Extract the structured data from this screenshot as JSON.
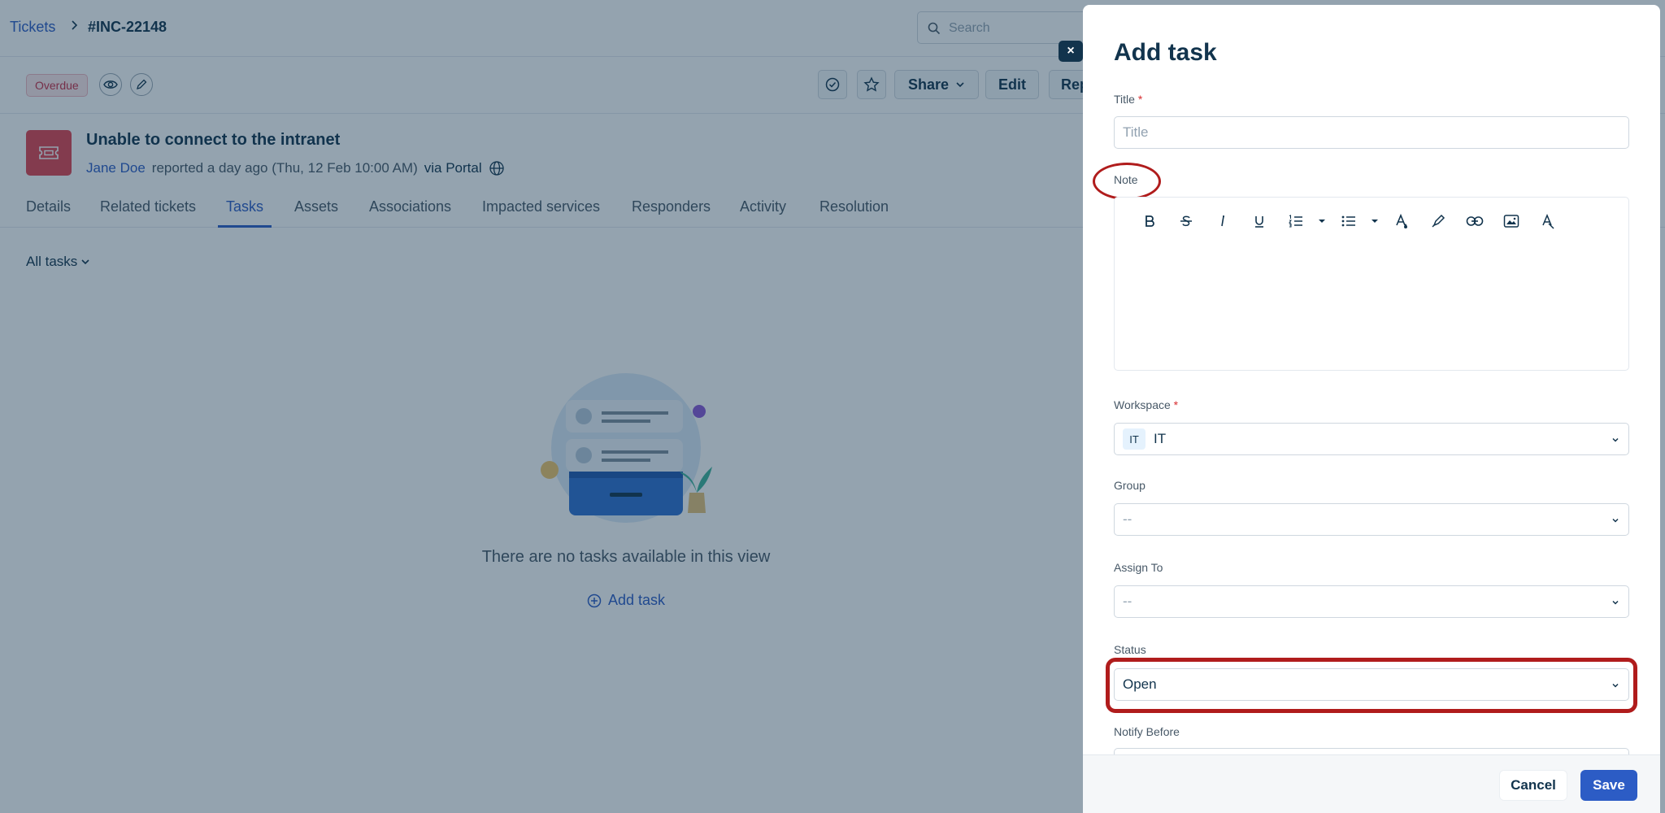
{
  "header": {
    "breadcrumb_root": "Tickets",
    "ticket_id": "#INC-22148",
    "search_placeholder": "Search"
  },
  "actionbar": {
    "status_badge": "Overdue",
    "share_label": "Share",
    "edit_label": "Edit",
    "reply_label": "Rep"
  },
  "ticket": {
    "title": "Unable to connect to the intranet",
    "author": "Jane Doe",
    "reported": "reported a day ago (Thu, 12 Feb 10:00 AM)",
    "via": "via Portal"
  },
  "tabs": [
    "Details",
    "Related tickets",
    "Tasks",
    "Assets",
    "Associations",
    "Impacted services",
    "Responders",
    "Activity",
    "Resolution"
  ],
  "active_tab": "Tasks",
  "tasks": {
    "filter_label": "All tasks",
    "empty_message": "There are no tasks available in this view",
    "add_task_label": "Add task"
  },
  "drawer": {
    "title": "Add task",
    "close_symbol": "×",
    "fields": {
      "title_label": "Title",
      "title_placeholder": "Title",
      "required_mark": "*",
      "note_label": "Note",
      "workspace_label": "Workspace",
      "workspace_chip": "IT",
      "workspace_value": "IT",
      "group_label": "Group",
      "group_value": "--",
      "assign_label": "Assign To",
      "assign_value": "--",
      "status_label": "Status",
      "status_value": "Open",
      "notify_label": "Notify Before"
    },
    "toolbar_icons": [
      "bold-icon",
      "strikethrough-icon",
      "italic-icon",
      "underline-icon",
      "ordered-list-icon",
      "unordered-list-icon",
      "text-color-icon",
      "highlight-icon",
      "link-icon",
      "image-icon",
      "clear-format-icon"
    ],
    "cancel_label": "Cancel",
    "save_label": "Save"
  },
  "colors": {
    "primary": "#2c5cc5",
    "text": "#12344d",
    "danger": "#e0424f",
    "annotation": "#b01c1c"
  }
}
